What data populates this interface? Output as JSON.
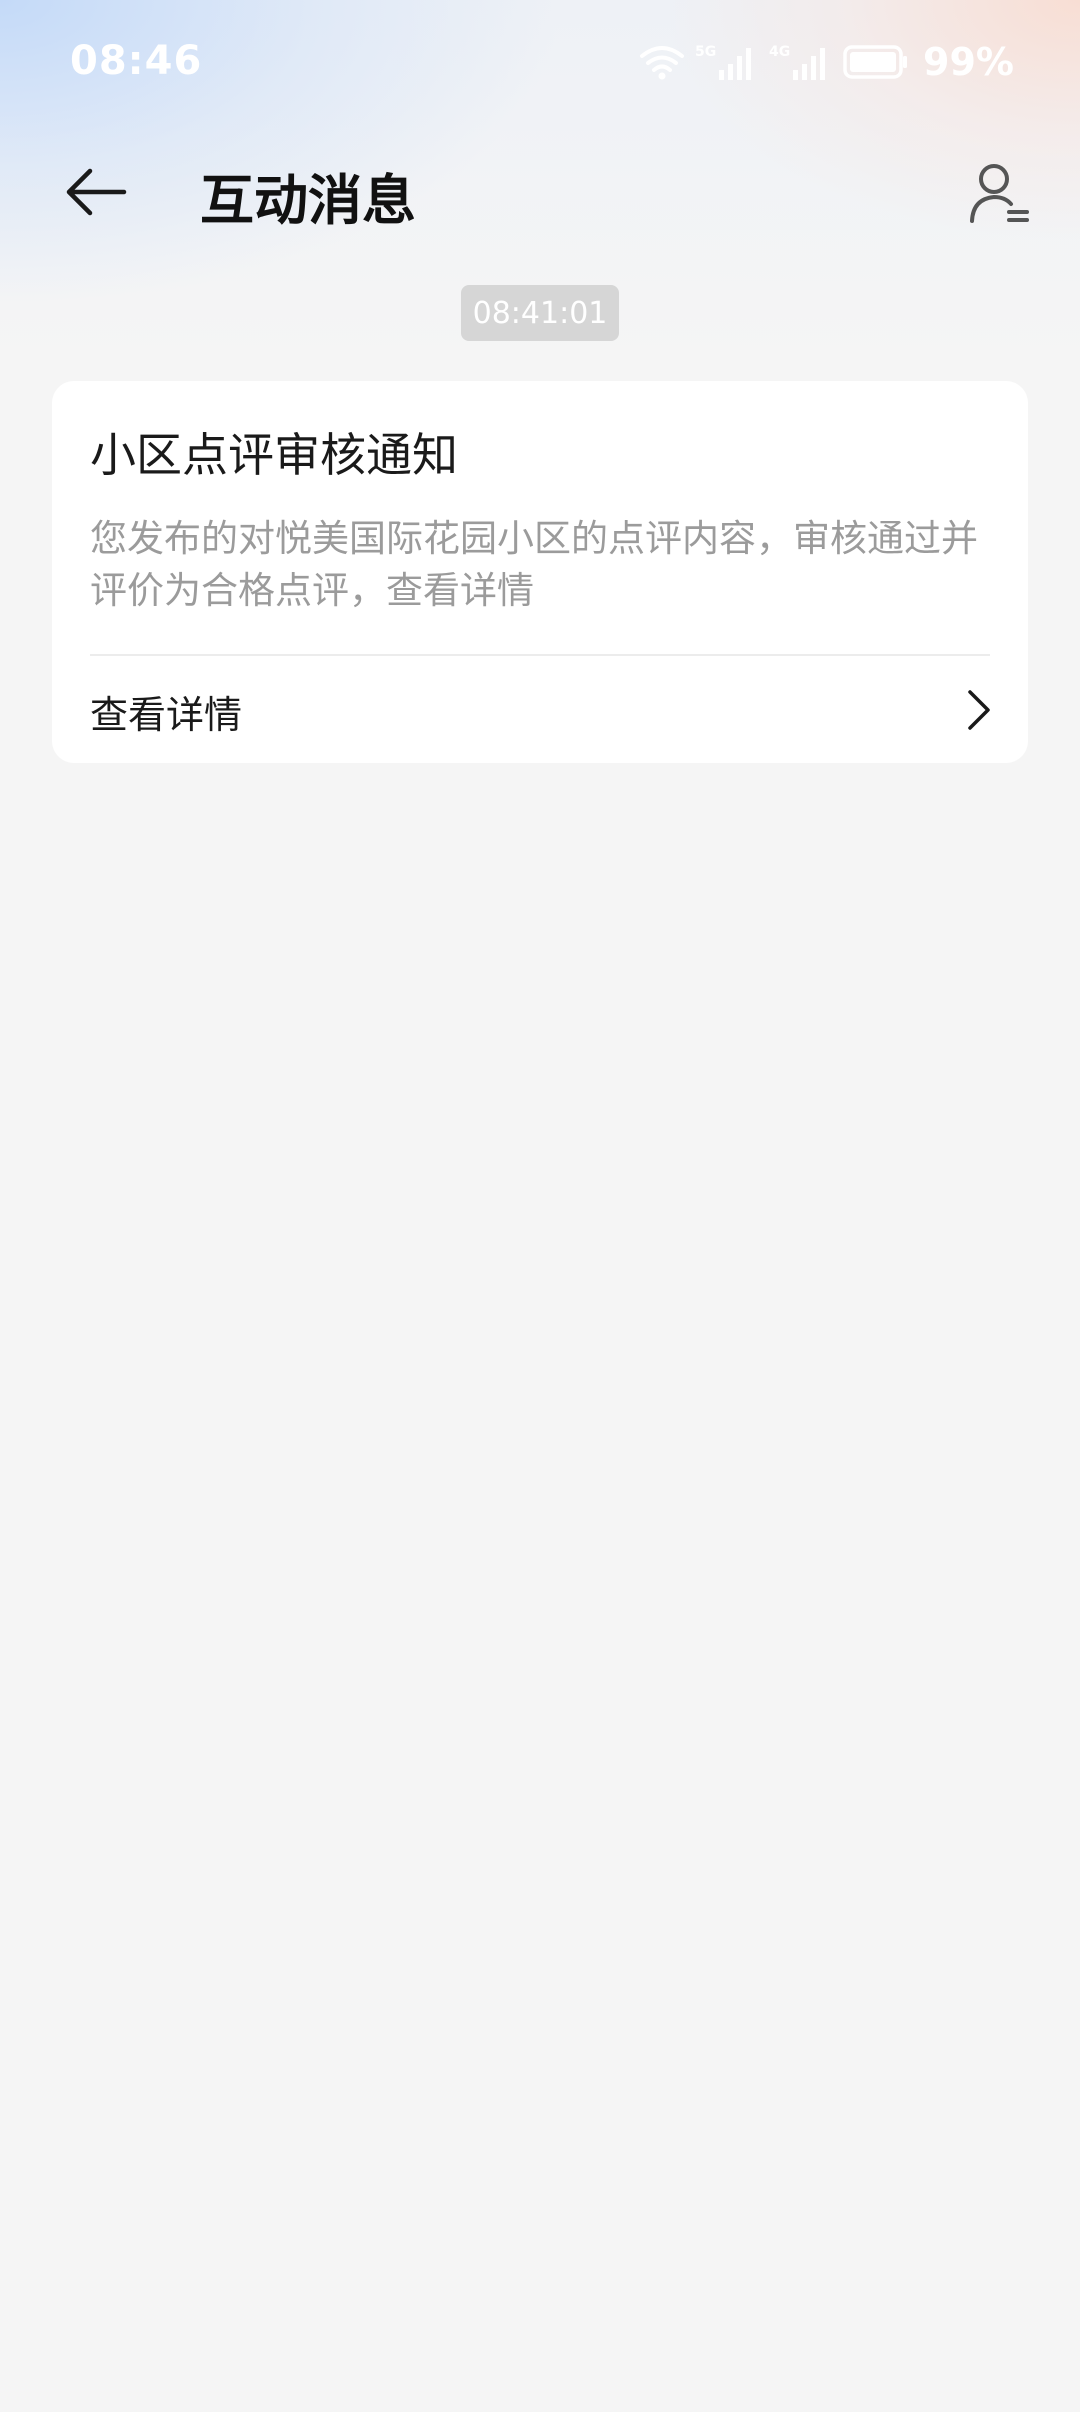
{
  "status_bar": {
    "time": "08:46",
    "network_a": "5G",
    "network_b": "4G",
    "battery": "99%"
  },
  "header": {
    "title": "互动消息",
    "icons": {
      "back": "arrow-left-icon",
      "profile": "user-list-icon"
    }
  },
  "messages": [
    {
      "timestamp": "08:41:01",
      "title": "小区点评审核通知",
      "body": "您发布的对悦美国际花园小区的点评内容，审核通过并评价为合格点评，查看详情",
      "action_label": "查看详情"
    }
  ],
  "colors": {
    "background": "#f5f5f5",
    "card": "#ffffff",
    "muted_text": "#9b9b9b",
    "chip": "#d6d6d6"
  }
}
